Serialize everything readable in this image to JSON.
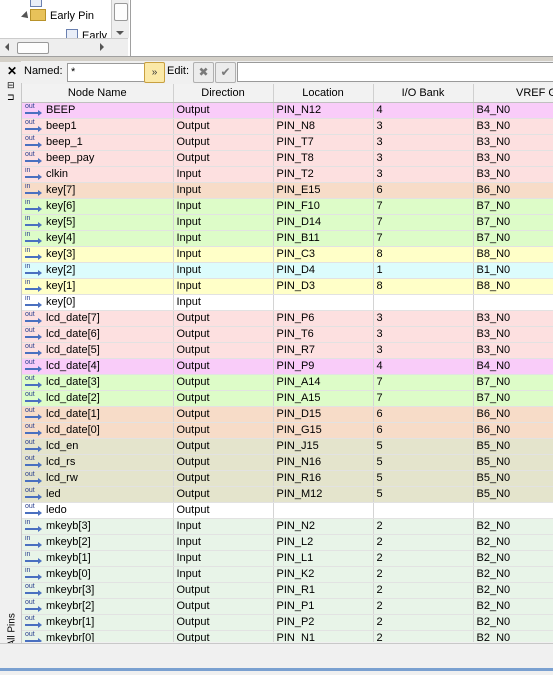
{
  "tree": {
    "items": [
      {
        "label": "Early Pin",
        "icon": "folder-icon"
      },
      {
        "label": "Early",
        "icon": "document-icon"
      }
    ]
  },
  "side": {
    "close": "✕",
    "vertical_label": "All Pins"
  },
  "toolbar": {
    "named_label": "Named:",
    "named_value": "*",
    "edit_label": "Edit:"
  },
  "table": {
    "columns": [
      "Node Name",
      "Direction",
      "Location",
      "I/O Bank",
      "VREF Group"
    ],
    "rows": [
      {
        "dir": "out",
        "name": "BEEP",
        "direction": "Output",
        "location": "PIN_N12",
        "bank": "4",
        "vref": "B4_N0",
        "color": "#f9ccf9"
      },
      {
        "dir": "out",
        "name": "beep1",
        "direction": "Output",
        "location": "PIN_N8",
        "bank": "3",
        "vref": "B3_N0",
        "color": "#fde0e0"
      },
      {
        "dir": "out",
        "name": "beep_1",
        "direction": "Output",
        "location": "PIN_T7",
        "bank": "3",
        "vref": "B3_N0",
        "color": "#fde0e0"
      },
      {
        "dir": "out",
        "name": "beep_pay",
        "direction": "Output",
        "location": "PIN_T8",
        "bank": "3",
        "vref": "B3_N0",
        "color": "#fde0e0"
      },
      {
        "dir": "in",
        "name": "clkin",
        "direction": "Input",
        "location": "PIN_T2",
        "bank": "3",
        "vref": "B3_N0",
        "color": "#fde0e0"
      },
      {
        "dir": "in",
        "name": "key[7]",
        "direction": "Input",
        "location": "PIN_E15",
        "bank": "6",
        "vref": "B6_N0",
        "color": "#f7dcc8"
      },
      {
        "dir": "in",
        "name": "key[6]",
        "direction": "Input",
        "location": "PIN_F10",
        "bank": "7",
        "vref": "B7_N0",
        "color": "#ddfcc8"
      },
      {
        "dir": "in",
        "name": "key[5]",
        "direction": "Input",
        "location": "PIN_D14",
        "bank": "7",
        "vref": "B7_N0",
        "color": "#ddfcc8"
      },
      {
        "dir": "in",
        "name": "key[4]",
        "direction": "Input",
        "location": "PIN_B11",
        "bank": "7",
        "vref": "B7_N0",
        "color": "#ddfcc8"
      },
      {
        "dir": "in",
        "name": "key[3]",
        "direction": "Input",
        "location": "PIN_C3",
        "bank": "8",
        "vref": "B8_N0",
        "color": "#ffffc8"
      },
      {
        "dir": "in",
        "name": "key[2]",
        "direction": "Input",
        "location": "PIN_D4",
        "bank": "1",
        "vref": "B1_N0",
        "color": "#dcfcfc"
      },
      {
        "dir": "in",
        "name": "key[1]",
        "direction": "Input",
        "location": "PIN_D3",
        "bank": "8",
        "vref": "B8_N0",
        "color": "#ffffc8"
      },
      {
        "dir": "in",
        "name": "key[0]",
        "direction": "Input",
        "location": "",
        "bank": "",
        "vref": "",
        "color": "#ffffff"
      },
      {
        "dir": "out",
        "name": "lcd_date[7]",
        "direction": "Output",
        "location": "PIN_P6",
        "bank": "3",
        "vref": "B3_N0",
        "color": "#fde0e0"
      },
      {
        "dir": "out",
        "name": "lcd_date[6]",
        "direction": "Output",
        "location": "PIN_T6",
        "bank": "3",
        "vref": "B3_N0",
        "color": "#fde0e0"
      },
      {
        "dir": "out",
        "name": "lcd_date[5]",
        "direction": "Output",
        "location": "PIN_R7",
        "bank": "3",
        "vref": "B3_N0",
        "color": "#fde0e0"
      },
      {
        "dir": "out",
        "name": "lcd_date[4]",
        "direction": "Output",
        "location": "PIN_P9",
        "bank": "4",
        "vref": "B4_N0",
        "color": "#f9ccf9"
      },
      {
        "dir": "out",
        "name": "lcd_date[3]",
        "direction": "Output",
        "location": "PIN_A14",
        "bank": "7",
        "vref": "B7_N0",
        "color": "#ddfcc8"
      },
      {
        "dir": "out",
        "name": "lcd_date[2]",
        "direction": "Output",
        "location": "PIN_A15",
        "bank": "7",
        "vref": "B7_N0",
        "color": "#ddfcc8"
      },
      {
        "dir": "out",
        "name": "lcd_date[1]",
        "direction": "Output",
        "location": "PIN_D15",
        "bank": "6",
        "vref": "B6_N0",
        "color": "#f7dcc8"
      },
      {
        "dir": "out",
        "name": "lcd_date[0]",
        "direction": "Output",
        "location": "PIN_G15",
        "bank": "6",
        "vref": "B6_N0",
        "color": "#f7dcc8"
      },
      {
        "dir": "out",
        "name": "lcd_en",
        "direction": "Output",
        "location": "PIN_J15",
        "bank": "5",
        "vref": "B5_N0",
        "color": "#e4e4cc"
      },
      {
        "dir": "out",
        "name": "lcd_rs",
        "direction": "Output",
        "location": "PIN_N16",
        "bank": "5",
        "vref": "B5_N0",
        "color": "#e4e4cc"
      },
      {
        "dir": "out",
        "name": "lcd_rw",
        "direction": "Output",
        "location": "PIN_R16",
        "bank": "5",
        "vref": "B5_N0",
        "color": "#e4e4cc"
      },
      {
        "dir": "out",
        "name": "led",
        "direction": "Output",
        "location": "PIN_M12",
        "bank": "5",
        "vref": "B5_N0",
        "color": "#e4e4cc"
      },
      {
        "dir": "out",
        "name": "ledo",
        "direction": "Output",
        "location": "",
        "bank": "",
        "vref": "",
        "color": "#ffffff"
      },
      {
        "dir": "in",
        "name": "mkeyb[3]",
        "direction": "Input",
        "location": "PIN_N2",
        "bank": "2",
        "vref": "B2_N0",
        "color": "#e8f4e8"
      },
      {
        "dir": "in",
        "name": "mkeyb[2]",
        "direction": "Input",
        "location": "PIN_L2",
        "bank": "2",
        "vref": "B2_N0",
        "color": "#e8f4e8"
      },
      {
        "dir": "in",
        "name": "mkeyb[1]",
        "direction": "Input",
        "location": "PIN_L1",
        "bank": "2",
        "vref": "B2_N0",
        "color": "#e8f4e8"
      },
      {
        "dir": "in",
        "name": "mkeyb[0]",
        "direction": "Input",
        "location": "PIN_K2",
        "bank": "2",
        "vref": "B2_N0",
        "color": "#e8f4e8"
      },
      {
        "dir": "out",
        "name": "mkeybr[3]",
        "direction": "Output",
        "location": "PIN_R1",
        "bank": "2",
        "vref": "B2_N0",
        "color": "#e8f4e8"
      },
      {
        "dir": "out",
        "name": "mkeybr[2]",
        "direction": "Output",
        "location": "PIN_P1",
        "bank": "2",
        "vref": "B2_N0",
        "color": "#e8f4e8"
      },
      {
        "dir": "out",
        "name": "mkeybr[1]",
        "direction": "Output",
        "location": "PIN_P2",
        "bank": "2",
        "vref": "B2_N0",
        "color": "#e8f4e8"
      },
      {
        "dir": "out",
        "name": "mkeybr[0]",
        "direction": "Output",
        "location": "PIN_N1",
        "bank": "2",
        "vref": "B2_N0",
        "color": "#e8f4e8"
      }
    ]
  }
}
